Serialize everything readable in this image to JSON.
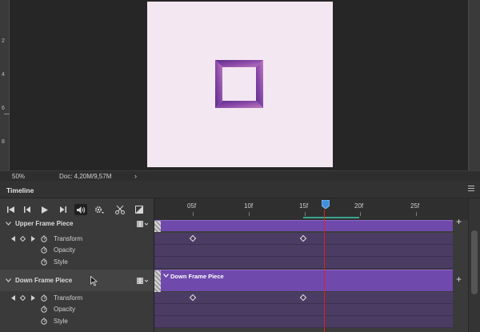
{
  "canvas": {
    "ruler_labels": [
      "2",
      "4",
      "6",
      "8"
    ],
    "doc_bg": "#f3e7f2",
    "art_colors": [
      "#5b2c8c",
      "#8a4aa8",
      "#c07ac0"
    ]
  },
  "status": {
    "zoom": "50%",
    "doc_info": "Doc: 4,20M/9,57M",
    "arrow": "›"
  },
  "timeline": {
    "title": "Timeline",
    "ruler": {
      "labels": [
        "05f",
        "10f",
        "15f",
        "20f",
        "25f"
      ]
    },
    "controls": [
      "go-to-first-frame",
      "previous-frame",
      "play",
      "next-frame",
      "audio",
      "settings",
      "split",
      "transition"
    ],
    "layers": [
      {
        "name": "Upper Frame Piece",
        "properties": [
          "Transform",
          "Opacity",
          "Style"
        ]
      },
      {
        "name": "Down Frame Piece",
        "clip_label": "Down Frame Piece",
        "properties": [
          "Transform",
          "Opacity",
          "Style"
        ]
      }
    ],
    "accent_clip": "#7049ad",
    "playhead_color": "#e02020"
  }
}
